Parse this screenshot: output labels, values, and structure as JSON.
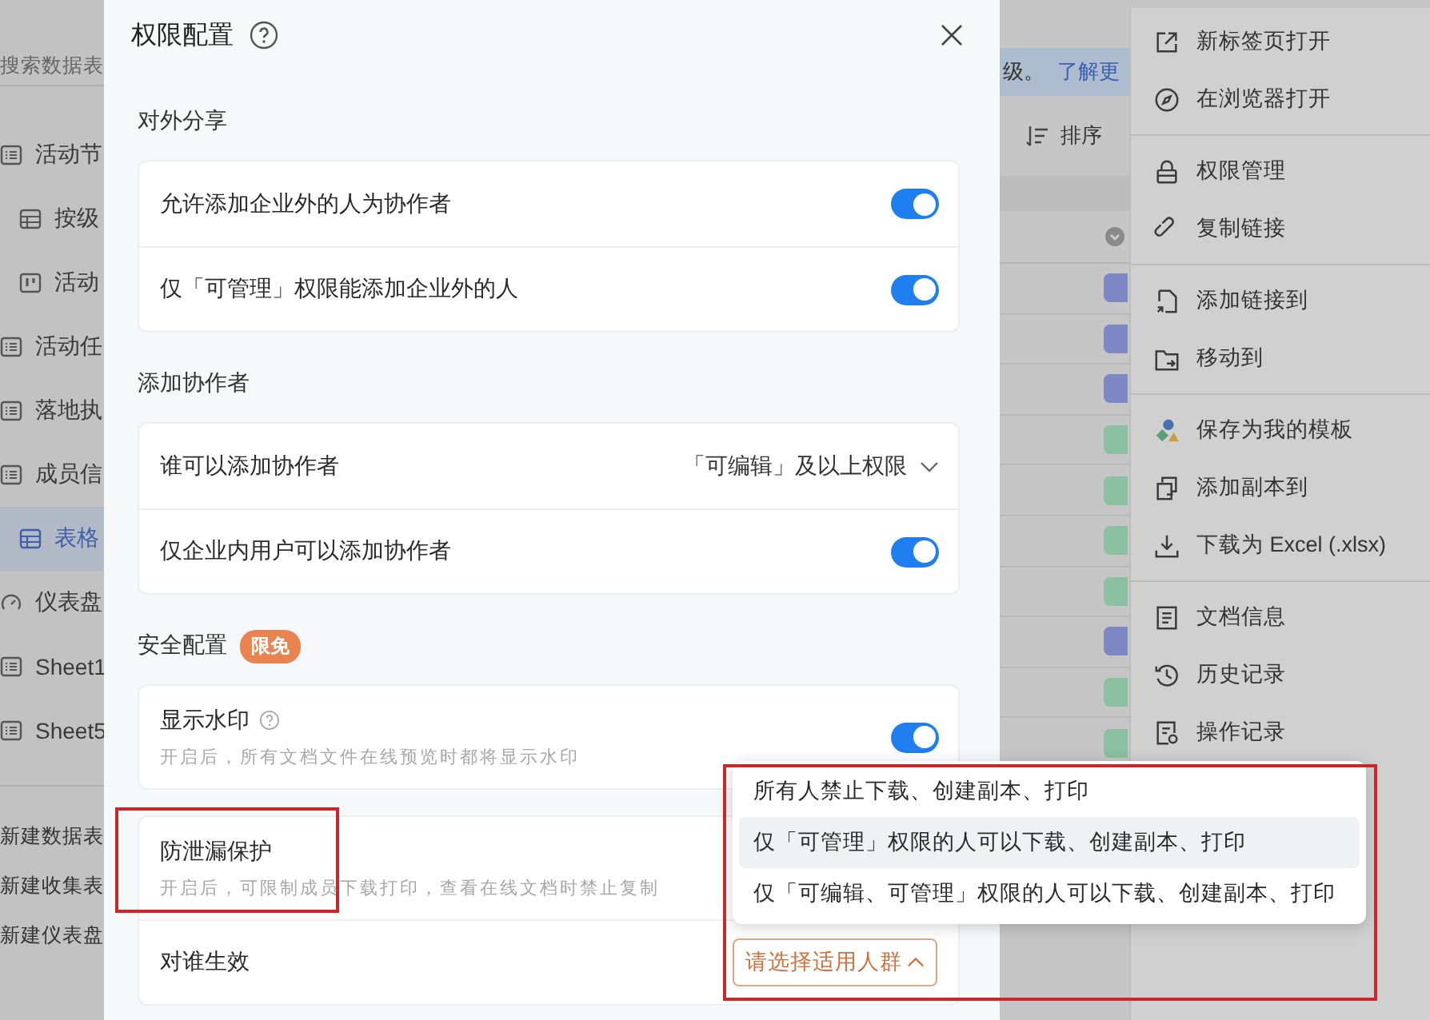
{
  "sidebar": {
    "search": {
      "placeholder": "搜索数据表"
    },
    "items": [
      {
        "label": "活动节",
        "kind": "list",
        "selected": false,
        "children": [
          {
            "label": "按级",
            "kind": "grid",
            "selected": false
          },
          {
            "label": "活动",
            "kind": "kanban",
            "selected": false
          }
        ]
      },
      {
        "label": "活动任",
        "kind": "list",
        "selected": false
      },
      {
        "label": "落地执",
        "kind": "list",
        "selected": false
      },
      {
        "label": "成员信",
        "kind": "list",
        "selected": false,
        "children": [
          {
            "label": "表格",
            "kind": "grid",
            "selected": true
          }
        ]
      },
      {
        "label": "仪表盘",
        "kind": "gauge",
        "selected": false
      },
      {
        "label": "Sheet1",
        "kind": "list",
        "selected": false
      },
      {
        "label": "Sheet5",
        "kind": "list",
        "selected": false
      }
    ],
    "actions": [
      "新建数据表",
      "新建收集表",
      "新建仪表盘"
    ]
  },
  "banner": {
    "text": "级。",
    "link": "了解更"
  },
  "toolbar": {
    "sort": "排序"
  },
  "table": {
    "tags": [
      {
        "color": "#7d88c4"
      },
      {
        "color": "#7d88c4"
      },
      {
        "color": "#7d88c4"
      },
      {
        "color": "#8cc0a2"
      },
      {
        "color": "#8cc0a2"
      },
      {
        "color": "#8cc0a2"
      },
      {
        "color": "#8cc0a2"
      },
      {
        "color": "#7d88c4"
      },
      {
        "color": "#8cc0a2"
      },
      {
        "color": "#8cc0a2"
      }
    ]
  },
  "dialog": {
    "title": "权限配置",
    "sections": [
      {
        "title": "对外分享",
        "cards": [
          {
            "rows": [
              {
                "kind": "toggle",
                "label": "允许添加企业外的人为协作者",
                "on": true
              },
              {
                "kind": "toggle",
                "label": "仅「可管理」权限能添加企业外的人",
                "on": true
              }
            ]
          }
        ]
      },
      {
        "title": "添加协作者",
        "cards": [
          {
            "rows": [
              {
                "kind": "select",
                "label": "谁可以添加协作者",
                "value": "「可编辑」及以上权限"
              },
              {
                "kind": "toggle",
                "label": "仅企业内用户可以添加协作者",
                "on": true
              }
            ]
          }
        ]
      },
      {
        "title": "安全配置",
        "badge": "限免",
        "cards": [
          {
            "rows": [
              {
                "kind": "toggle",
                "label": "显示水印",
                "help": true,
                "hint": "开启后，所有文档文件在线预览时都将显示水印",
                "on": true
              }
            ]
          },
          {
            "rows": [
              {
                "kind": "info",
                "label": "防泄漏保护",
                "hint": "开启后，可限制成员下载打印，查看在线文档时禁止复制"
              },
              {
                "kind": "picker",
                "label": "对谁生效",
                "button": "请选择适用人群",
                "expanded": true,
                "options": [
                  {
                    "label": "所有人禁止下载、创建副本、打印",
                    "selected": false
                  },
                  {
                    "label": "仅「可管理」权限的人可以下载、创建副本、打印",
                    "selected": true
                  },
                  {
                    "label": "仅「可编辑、可管理」权限的人可以下载、创建副本、打印",
                    "selected": false
                  }
                ]
              }
            ]
          }
        ]
      }
    ]
  },
  "context_menu": {
    "groups": [
      [
        {
          "label": "新标签页打开",
          "kind": "new-tab"
        },
        {
          "label": "在浏览器打开",
          "kind": "compass"
        }
      ],
      [
        {
          "label": "权限管理",
          "kind": "lock"
        },
        {
          "label": "复制链接",
          "kind": "link"
        }
      ],
      [
        {
          "label": "添加链接到",
          "kind": "add-link"
        },
        {
          "label": "移动到",
          "kind": "folder"
        }
      ],
      [
        {
          "label": "保存为我的模板",
          "kind": "template"
        },
        {
          "label": "添加副本到",
          "kind": "copy"
        },
        {
          "label": "下载为 Excel (.xlsx)",
          "kind": "download"
        }
      ],
      [
        {
          "label": "文档信息",
          "kind": "doc"
        },
        {
          "label": "历史记录",
          "kind": "history"
        },
        {
          "label": "操作记录",
          "kind": "log"
        }
      ]
    ]
  }
}
